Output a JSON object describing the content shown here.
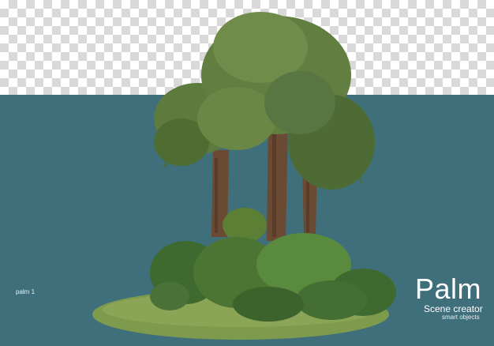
{
  "labels": {
    "small": "palm 1",
    "title": "Palm",
    "subtitle": "Scene creator",
    "tagline": "smart objects"
  },
  "colors": {
    "background_teal": "#3f6f7b",
    "checker_light": "#ffffff",
    "checker_dark": "#d9d9d9",
    "frond_green": "#5f7f3f",
    "trunk_brown": "#6b4a33",
    "grass_green": "#7e9a4c"
  }
}
